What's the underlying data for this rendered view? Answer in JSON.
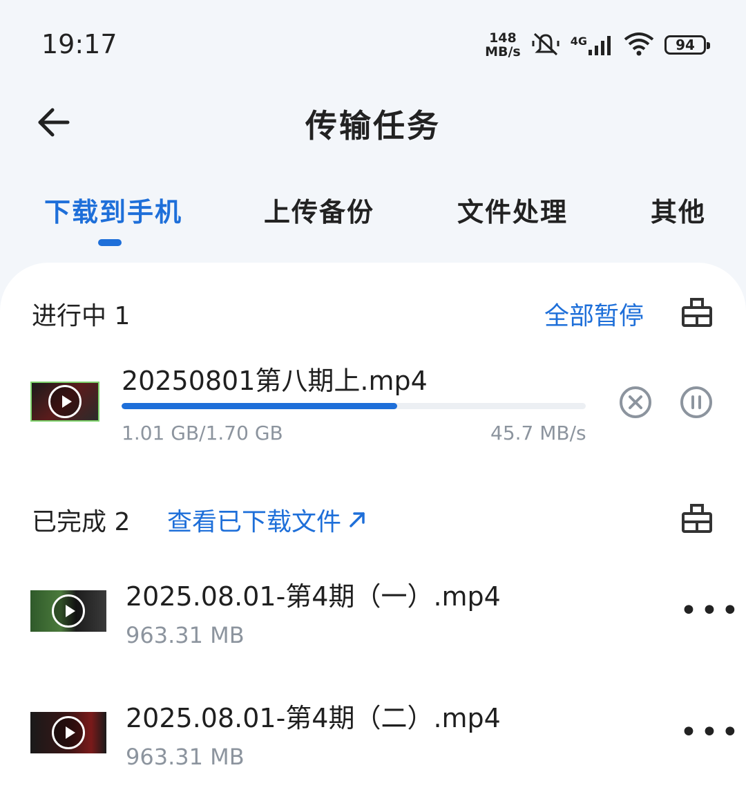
{
  "status_bar": {
    "time": "19:17",
    "net_speed_value": "148",
    "net_speed_unit": "MB/s",
    "network_type": "4G",
    "battery": "94"
  },
  "header": {
    "title": "传输任务"
  },
  "tabs": [
    {
      "label": "下载到手机",
      "active": true
    },
    {
      "label": "上传备份",
      "active": false
    },
    {
      "label": "文件处理",
      "active": false
    },
    {
      "label": "其他",
      "active": false
    }
  ],
  "in_progress": {
    "title": "进行中 1",
    "pause_all_label": "全部暂停",
    "items": [
      {
        "name": "20250801第八期上.mp4",
        "size_progress": "1.01 GB/1.70 GB",
        "speed": "45.7 MB/s",
        "progress": 0.594
      }
    ]
  },
  "completed": {
    "title": "已完成 2",
    "view_link": "查看已下载文件",
    "items": [
      {
        "name": "2025.08.01-第4期（一）.mp4",
        "size": "963.31 MB"
      },
      {
        "name": "2025.08.01-第4期（二）.mp4",
        "size": "963.31 MB"
      }
    ]
  },
  "colors": {
    "accent": "#1e6fd9",
    "background": "#f3f6fa",
    "card": "#ffffff",
    "muted_text": "#8c949e"
  },
  "icons": [
    "back-arrow-icon",
    "clear-icon",
    "cancel-icon",
    "pause-icon",
    "more-icon",
    "play-icon",
    "external-link-icon"
  ]
}
